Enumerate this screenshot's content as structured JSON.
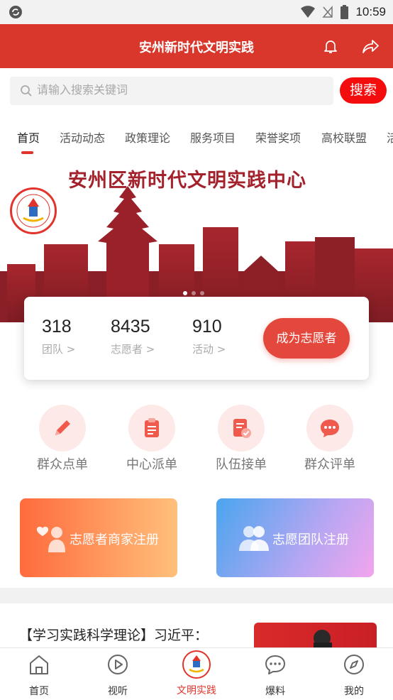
{
  "status_bar": {
    "time": "10:59",
    "icons": [
      "sync-icon",
      "wifi-icon",
      "no-signal-icon",
      "battery-icon"
    ]
  },
  "header": {
    "title": "安州新时代文明实践",
    "icons": [
      "bell-icon",
      "share-icon"
    ]
  },
  "search": {
    "placeholder": "请输入搜索关键词",
    "button_label": "搜索"
  },
  "tabs": [
    {
      "label": "首页",
      "active": true
    },
    {
      "label": "活动动态"
    },
    {
      "label": "政策理论"
    },
    {
      "label": "服务项目"
    },
    {
      "label": "荣誉奖项"
    },
    {
      "label": "高校联盟"
    },
    {
      "label": "活"
    }
  ],
  "banner": {
    "title": "安州区新时代文明实践中心",
    "slide_count": 3,
    "active_slide": 1
  },
  "stats": [
    {
      "value": "318",
      "label": "团队 >"
    },
    {
      "value": "8435",
      "label": "志愿者 >"
    },
    {
      "value": "910",
      "label": "活动 >"
    }
  ],
  "cta_label": "成为志愿者",
  "quick_actions": [
    {
      "label": "群众点单",
      "icon": "pencil-icon"
    },
    {
      "label": "中心派单",
      "icon": "clipboard-icon"
    },
    {
      "label": "队伍接单",
      "icon": "document-check-icon"
    },
    {
      "label": "群众评单",
      "icon": "chat-bubble-icon"
    }
  ],
  "registration": [
    {
      "label": "志愿者商家注册",
      "icon": "volunteer-heart-icon"
    },
    {
      "label": "志愿团队注册",
      "icon": "team-people-icon"
    }
  ],
  "news": {
    "title": "【学习实践科学理论】习近平："
  },
  "bottom_nav": [
    {
      "label": "首页",
      "icon": "home-icon"
    },
    {
      "label": "视听",
      "icon": "play-icon"
    },
    {
      "label": "文明实践",
      "icon": "civilization-logo-icon",
      "active": true
    },
    {
      "label": "爆料",
      "icon": "chat-icon"
    },
    {
      "label": "我的",
      "icon": "compass-icon"
    }
  ],
  "colors": {
    "brand_red": "#d9372c",
    "search_button": "#f40d0d",
    "banner_red": "#a3222c",
    "cta": "#e4473c"
  }
}
